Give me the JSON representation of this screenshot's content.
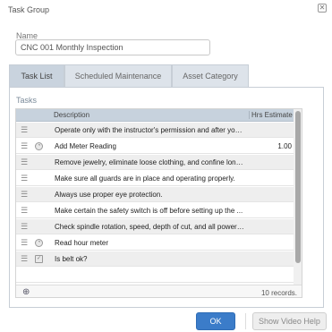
{
  "window": {
    "title": "Task Group",
    "close_symbol": "✕"
  },
  "name_field": {
    "label": "Name",
    "value": "CNC 001 Monthly Inspection"
  },
  "tabs": [
    {
      "label": "Task List",
      "active": true
    },
    {
      "label": "Scheduled Maintenance",
      "active": false
    },
    {
      "label": "Asset Category",
      "active": false
    }
  ],
  "tasks": {
    "section_label": "Tasks",
    "columns": {
      "description": "Description",
      "hours": "Hrs Estimate"
    },
    "rows": [
      {
        "description": "Operate only with the instructor's permission and after you...",
        "hours": "",
        "icon": ""
      },
      {
        "description": "Add Meter Reading",
        "hours": "1.00",
        "icon": "meter-icon"
      },
      {
        "description": "Remove jewelry, eliminate loose clothing, and confine long...",
        "hours": "",
        "icon": ""
      },
      {
        "description": "Make sure all guards are in place and operating properly.",
        "hours": "",
        "icon": ""
      },
      {
        "description": "Always use proper eye protection.",
        "hours": "",
        "icon": ""
      },
      {
        "description": "Make certain the safety switch is off before setting up the ...",
        "hours": "",
        "icon": ""
      },
      {
        "description": "Check spindle rotation, speed, depth of cut, and all power ...",
        "hours": "",
        "icon": ""
      },
      {
        "description": "Read hour meter",
        "hours": "",
        "icon": "meter-icon"
      },
      {
        "description": "Is belt ok?",
        "hours": "",
        "icon": "checkbox-icon"
      }
    ],
    "record_count": "10 records."
  },
  "buttons": {
    "ok": "OK",
    "help": "Show Video Help"
  }
}
